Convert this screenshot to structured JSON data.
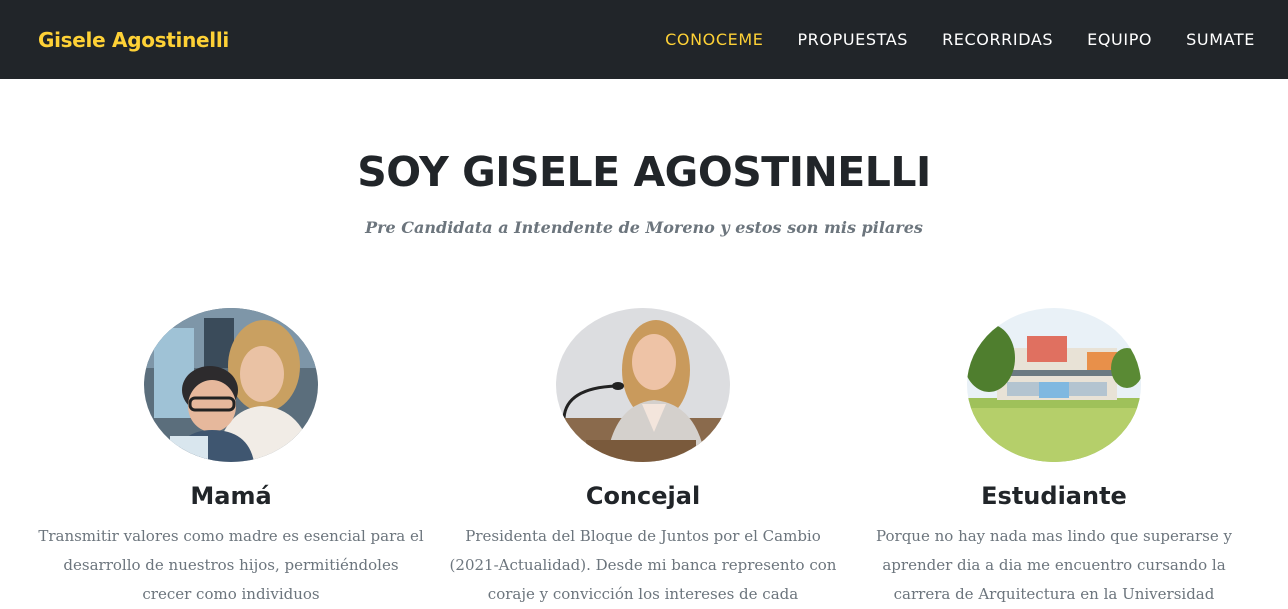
{
  "nav": {
    "brand": "Gisele Agostinelli",
    "links": [
      {
        "label": "CONOCEME",
        "active": true
      },
      {
        "label": "PROPUESTAS",
        "active": false
      },
      {
        "label": "RECORRIDAS",
        "active": false
      },
      {
        "label": "EQUIPO",
        "active": false
      },
      {
        "label": "SUMATE",
        "active": false
      }
    ],
    "accent_color": "#fed136",
    "background_color": "#212529"
  },
  "hero": {
    "heading": "SOY GISELE AGOSTINELLI",
    "subheading": "Pre Candidata a Intendente de Moreno y estos son mis pilares"
  },
  "pillars": [
    {
      "title": "Mamá",
      "photo": "mother-and-son-photo",
      "text": "Transmitir valores como madre es esencial para el desarrollo de nuestros hijos, permitiéndoles crecer como individuos"
    },
    {
      "title": "Concejal",
      "photo": "council-member-photo",
      "text": "Presidenta del Bloque de Juntos por el Cambio (2021-Actualidad). Desde mi banca represento con coraje y convicción los intereses de cada"
    },
    {
      "title": "Estudiante",
      "photo": "university-campus-photo",
      "text": "Porque no hay nada mas lindo que superarse y aprender dia a dia me encuentro cursando la carrera de Arquitectura en la Universidad"
    }
  ]
}
